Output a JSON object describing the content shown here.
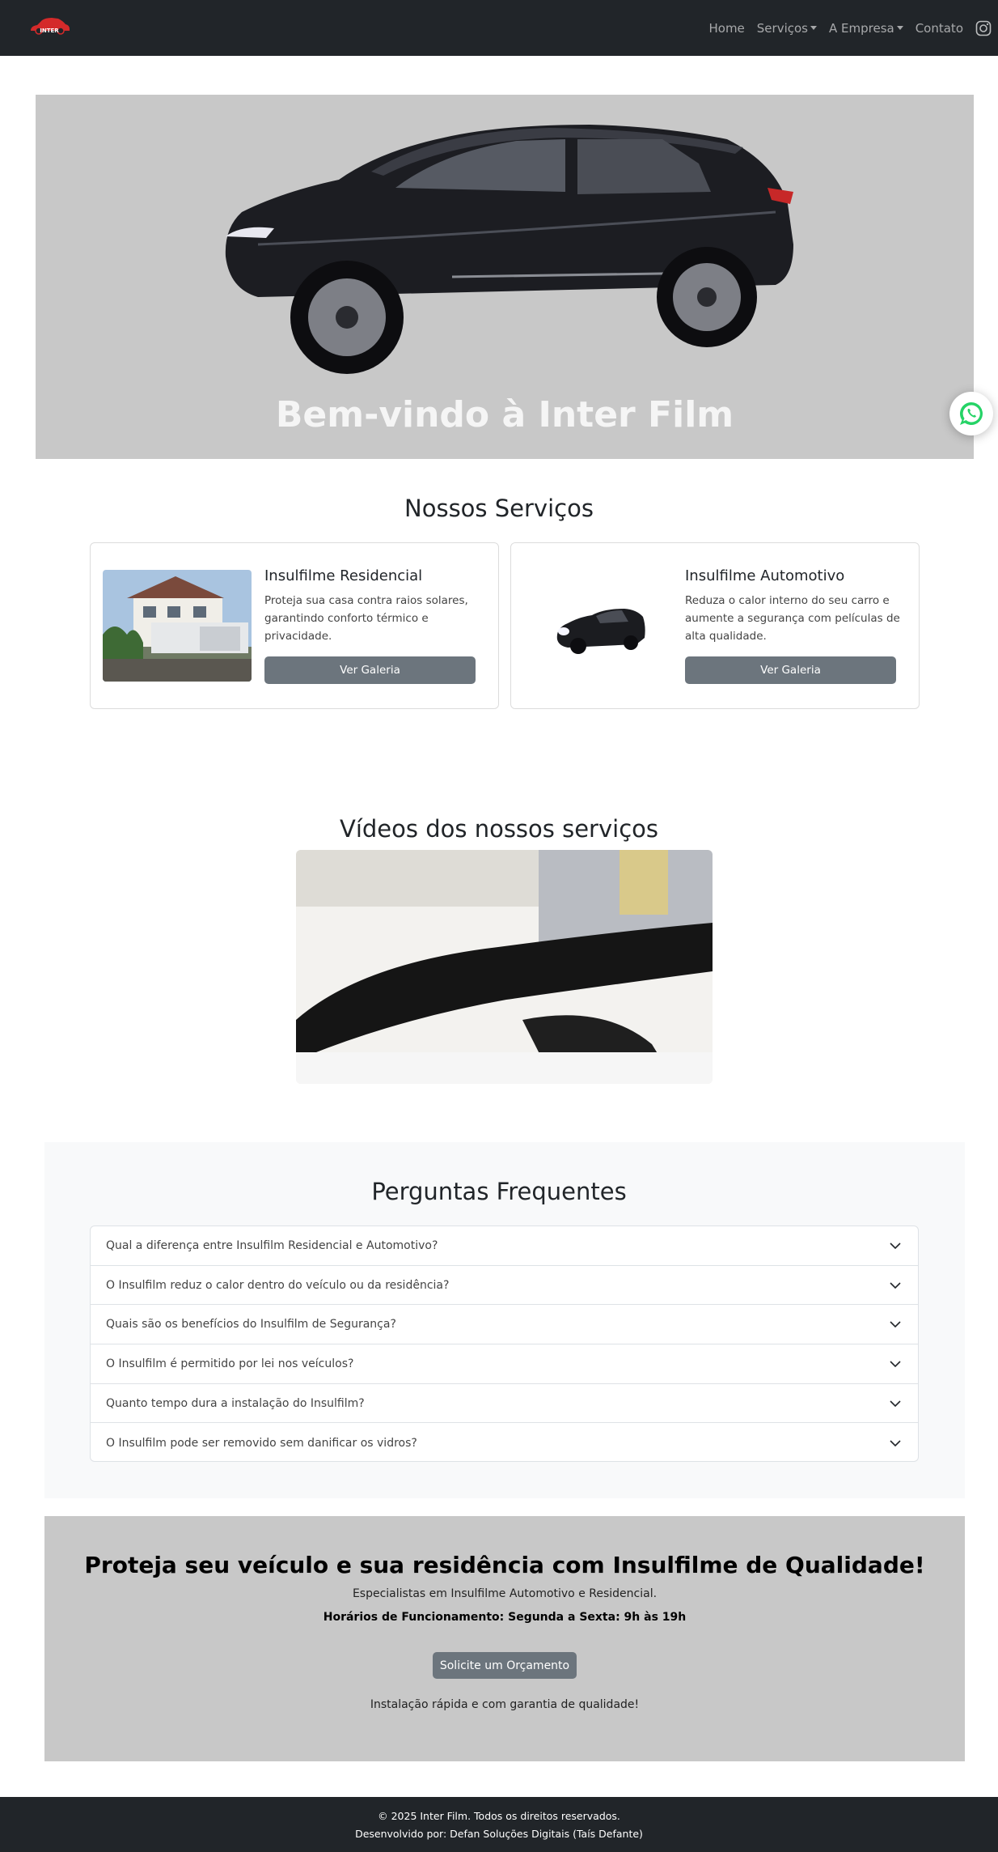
{
  "navbar": {
    "logo_text": "INTER",
    "links": {
      "home": "Home",
      "services": "Serviços",
      "company": "A Empresa",
      "contact": "Contato"
    }
  },
  "hero": {
    "title": "Bem-vindo à Inter Film"
  },
  "services": {
    "title": "Nossos Serviços",
    "cards": [
      {
        "title": "Insulfilme Residencial",
        "text": "Proteja sua casa contra raios solares, garantindo conforto térmico e privacidade.",
        "button": "Ver Galeria"
      },
      {
        "title": "Insulfilme Automotivo",
        "text": "Reduza o calor interno do seu carro e aumente a segurança com películas de alta qualidade.",
        "button": "Ver Galeria"
      }
    ]
  },
  "videos": {
    "title": "Vídeos dos nossos serviços"
  },
  "faq": {
    "title": "Perguntas Frequentes",
    "items": [
      "Qual a diferença entre Insulfilm Residencial e Automotivo?",
      "O Insulfilm reduz o calor dentro do veículo ou da residência?",
      "Quais são os benefícios do Insulfilm de Segurança?",
      "O Insulfilm é permitido por lei nos veículos?",
      "Quanto tempo dura a instalação do Insulfilm?",
      "O Insulfilm pode ser removido sem danificar os vidros?"
    ]
  },
  "cta": {
    "title": "Proteja seu veículo e sua residência com Insulfilme de Qualidade!",
    "subtitle": "Especialistas em Insulfilme Automotivo e Residencial.",
    "hours": "Horários de Funcionamento: Segunda a Sexta: 9h às 19h",
    "button": "Solicite um Orçamento",
    "note": "Instalação rápida e com garantia de qualidade!"
  },
  "footer": {
    "copyright": "© 2025 Inter Film. Todos os direitos reservados.",
    "developer": "Desenvolvido por: Defan Soluções Digitais (Taís Defante)"
  },
  "icons": {
    "logo": "car-logo-icon",
    "instagram": "instagram-icon",
    "whatsapp": "whatsapp-icon",
    "chevron": "chevron-down-icon"
  },
  "colors": {
    "navbar_bg": "#212529",
    "hero_bg": "#c8c8c8",
    "button_bg": "#6c757d",
    "faq_bg": "#f8f9fa",
    "logo_red": "#d42a2a",
    "whatsapp_green": "#25d366"
  }
}
